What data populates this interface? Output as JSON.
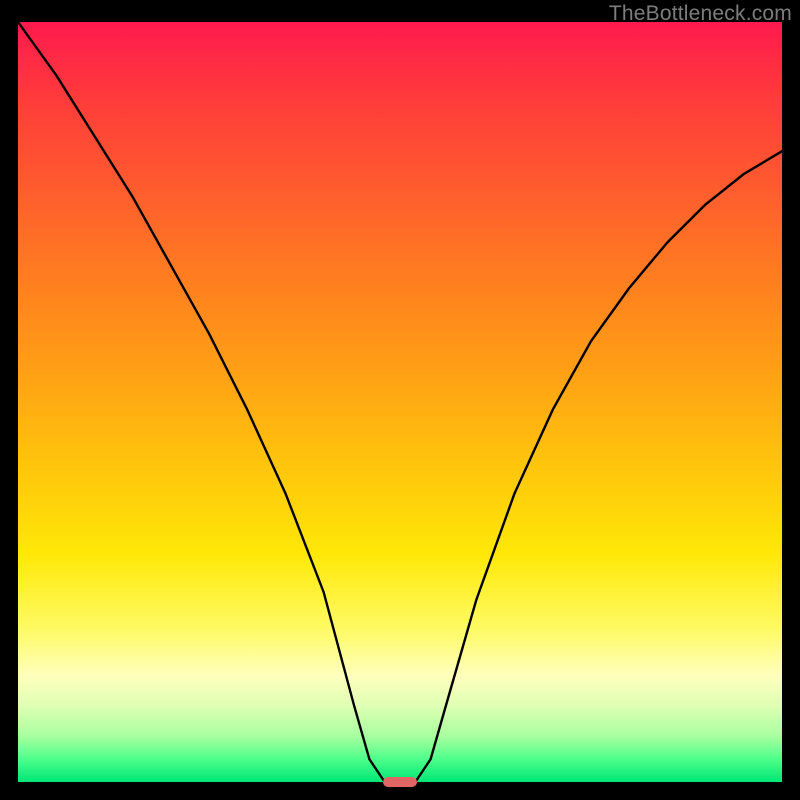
{
  "watermark": {
    "text": "TheBottleneck.com"
  },
  "chart_data": {
    "type": "line",
    "title": "",
    "xlabel": "",
    "ylabel": "",
    "xlim": [
      0,
      100
    ],
    "ylim": [
      0,
      100
    ],
    "series": [
      {
        "name": "bottleneck-curve",
        "x": [
          0,
          5,
          10,
          15,
          20,
          25,
          30,
          35,
          40,
          44,
          46,
          48,
          50,
          52,
          54,
          56,
          60,
          65,
          70,
          75,
          80,
          85,
          90,
          95,
          100
        ],
        "y": [
          100,
          93,
          85,
          77,
          68,
          59,
          49,
          38,
          25,
          10,
          3,
          0,
          0,
          0,
          3,
          10,
          24,
          38,
          49,
          58,
          65,
          71,
          76,
          80,
          83
        ]
      }
    ],
    "marker": {
      "name": "optimum-pill",
      "x_center": 50,
      "y": 0,
      "width_pct": 4.5,
      "height_pct": 1.4,
      "color": "#e06666"
    },
    "background": {
      "type": "vertical-gradient",
      "stops": [
        {
          "pct": 0,
          "color": "#ff1a4d"
        },
        {
          "pct": 50,
          "color": "#ffc400"
        },
        {
          "pct": 80,
          "color": "#fffb66"
        },
        {
          "pct": 100,
          "color": "#00e676"
        }
      ]
    }
  }
}
